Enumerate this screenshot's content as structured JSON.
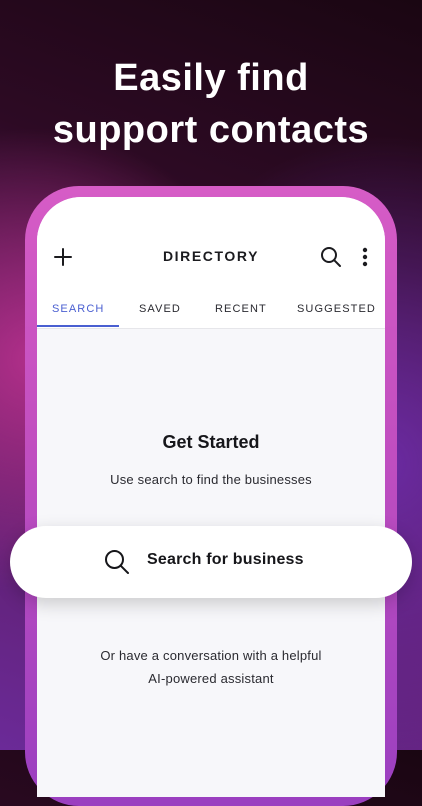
{
  "headline": {
    "line1": "Easily find",
    "line2": "support contacts"
  },
  "appbar": {
    "title": "DIRECTORY",
    "icons": {
      "left": "plus-icon",
      "search": "search-icon",
      "menu": "more-vertical-icon"
    }
  },
  "tabs": [
    {
      "label": "SEARCH",
      "active": true
    },
    {
      "label": "SAVED",
      "active": false
    },
    {
      "label": "RECENT",
      "active": false
    },
    {
      "label": "SUGGESTED",
      "active": false
    }
  ],
  "empty_state": {
    "title": "Get Started",
    "subtitle": "Use search to find the businesses"
  },
  "search_button": {
    "label": "Search for business",
    "icon": "search-icon"
  },
  "footer": {
    "line1": "Or have a conversation with a helpful",
    "line2": "AI-powered assistant"
  },
  "colors": {
    "accent": "#4a5fd1",
    "frame": "#c24fc0"
  }
}
